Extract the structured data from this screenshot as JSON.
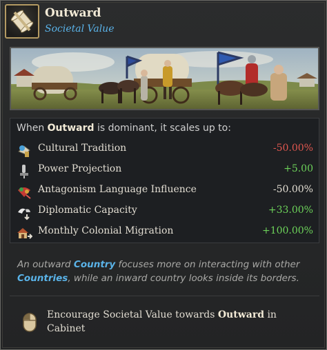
{
  "header": {
    "title": "Outward",
    "subtitle": "Societal Value",
    "icon": "scroll-icon"
  },
  "effects": {
    "intro_prefix": "When ",
    "intro_subject": "Outward",
    "intro_suffix": " is dominant, it scales up to:",
    "rows": [
      {
        "icon": "cultural-tradition-icon",
        "label": "Cultural Tradition",
        "value": "-50.00%",
        "color": "#e0574f"
      },
      {
        "icon": "power-projection-icon",
        "label": "Power Projection",
        "value": "+5.00",
        "color": "#6dd35a"
      },
      {
        "icon": "antagonism-language-icon",
        "label": "Antagonism Language Influence",
        "value": "-50.00%",
        "color": "#e2ddd2"
      },
      {
        "icon": "diplomatic-capacity-icon",
        "label": "Diplomatic Capacity",
        "value": "+33.00%",
        "color": "#6dd35a"
      },
      {
        "icon": "colonial-migration-icon",
        "label": "Monthly Colonial Migration",
        "value": "+100.00%",
        "color": "#6dd35a"
      }
    ]
  },
  "description": {
    "p1": "An outward ",
    "k1": "Country",
    "p2": " focuses more on interacting with other ",
    "k2": "Countries",
    "p3": ", while an inward country looks inside its borders."
  },
  "action": {
    "icon": "mouse-icon",
    "prefix": "Encourage Societal Value towards ",
    "target": "Outward",
    "suffix": " in Cabinet"
  },
  "colors": {
    "accent_blue": "#5ab3e8",
    "positive": "#6dd35a",
    "negative": "#e0574f",
    "gold_border": "#b49a62"
  }
}
